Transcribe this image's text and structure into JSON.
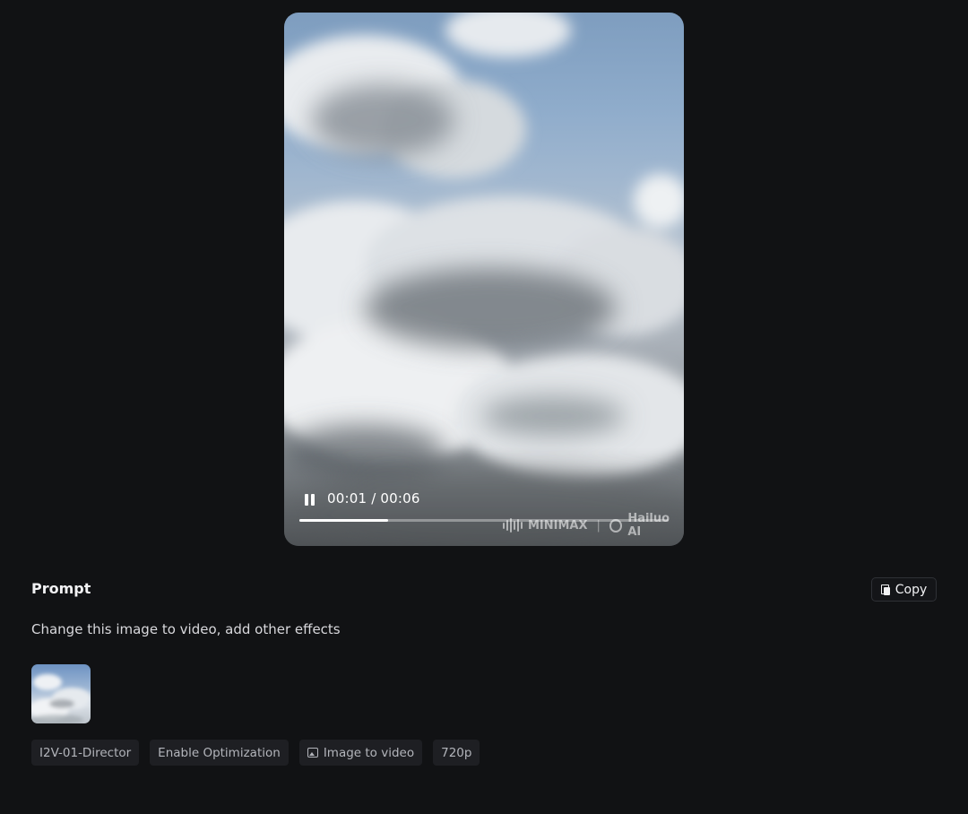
{
  "player": {
    "time_display": "00:01 / 00:06",
    "progress_fraction": 0.24,
    "watermark_brand": "MINIMAX",
    "watermark_product": "Hailuo AI",
    "pause_icon": "pause-icon"
  },
  "prompt": {
    "title": "Prompt",
    "copy_label": "Copy",
    "copy_icon": "copy-icon",
    "text": "Change this image to video, add other effects"
  },
  "tags": [
    {
      "label": "I2V-01-Director"
    },
    {
      "label": "Enable Optimization"
    },
    {
      "label": "Image to video",
      "icon": "image-icon"
    },
    {
      "label": "720p"
    }
  ],
  "colors": {
    "background": "#111214",
    "tag_background": "#1e1f23",
    "text_primary": "#f2f2f4"
  }
}
